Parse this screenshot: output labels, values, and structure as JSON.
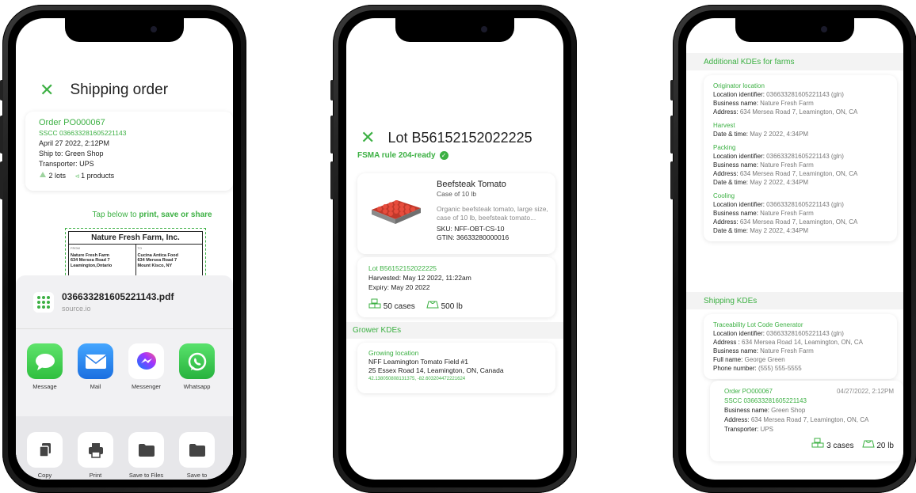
{
  "phone1": {
    "title": "Shipping order",
    "order": {
      "title": "Order PO000067",
      "sscc": "SSCC 036633281605221143",
      "date": "April 27 2022, 2:12PM",
      "ship_to": "Ship to: Green Shop",
      "transporter": "Transporter: UPS",
      "lots": "2 lots",
      "products": "1 products"
    },
    "tap_prefix": "Tap below to ",
    "tap_actions": "print, save or share",
    "label": {
      "company": "Nature Fresh Farm, Inc.",
      "from_label": "FROM",
      "from_lines": [
        "Nature Fresh Farm",
        "634 Mersea Road 7",
        "Leamington,Ontario"
      ],
      "to_label": "TO",
      "to_lines": [
        "Cucina Antica Food",
        "634 Mersea Road 7",
        "Mount Kisco, NY"
      ]
    },
    "share": {
      "file_name": "036633281605221143.pdf",
      "file_source": "source.io",
      "apps": [
        {
          "label": "Message",
          "icon": "message-icon"
        },
        {
          "label": "Mail",
          "icon": "mail-icon"
        },
        {
          "label": "Messenger",
          "icon": "messenger-icon"
        },
        {
          "label": "Whatsapp",
          "icon": "whatsapp-icon"
        }
      ],
      "actions": [
        {
          "label": "Copy",
          "icon": "copy-icon"
        },
        {
          "label": "Print",
          "icon": "print-icon"
        },
        {
          "label": "Save to Files",
          "icon": "folder-icon"
        },
        {
          "label": "Save to Dropbox",
          "icon": "folder-icon"
        }
      ]
    }
  },
  "phone2": {
    "title": "Lot B56152152022225",
    "fsma": "FSMA rule 204-ready",
    "product": {
      "name": "Beefsteak Tomato",
      "pack": "Case of 10 lb",
      "description": "Organic beefsteak tomato, large size, case of 10 lb, beefsteak tomato...",
      "sku": "SKU: NFF-OBT-CS-10",
      "gtin": "GTIN: 36633280000016"
    },
    "lot": {
      "lot": "Lot B56152152022225",
      "harvested": "Harvested: May 12 2022, 11:22am",
      "expiry": "Expiry: May 20 2022",
      "cases": "50 cases",
      "weight": "500 lb"
    },
    "grower_section": "Grower KDEs",
    "grower": {
      "label": "Growing location",
      "field": "NFF Leamington Tomato Field #1",
      "address": "25 Essex Road 14, Leamington, ON, Canada",
      "coords": "42.138050808131375, -82.603204472221624"
    }
  },
  "phone3": {
    "farms_section": "Additional KDEs for farms",
    "originator": {
      "title": "Originator location",
      "location_label": "Location identifier:",
      "location_value": "036633281605221143 (gln)",
      "business_label": "Business name:",
      "business_value": "Nature Fresh Farm",
      "address_label": "Address:",
      "address_value": "634 Mersea Road 7, Leamington, ON, CA"
    },
    "harvest": {
      "title": "Harvest",
      "date_label": "Date & time:",
      "date_value": "May 2 2022, 4:34PM"
    },
    "packing": {
      "title": "Packing",
      "location_label": "Location identifier:",
      "location_value": "036633281605221143 (gln)",
      "business_label": "Business name:",
      "business_value": "Nature Fresh Farm",
      "address_label": "Address:",
      "address_value": "634 Mersea Road 7, Leamington, ON, CA",
      "date_label": "Date & time:",
      "date_value": "May 2 2022, 4:34PM"
    },
    "cooling": {
      "title": "Cooling",
      "location_label": "Location identifier:",
      "location_value": "036633281605221143 (gln)",
      "business_label": "Business name:",
      "business_value": "Nature Fresh Farm",
      "address_label": "Address:",
      "address_value": "634 Mersea Road 7, Leamington, ON, CA",
      "date_label": "Date & time:",
      "date_value": "May 2 2022, 4:34PM"
    },
    "shipping_section": "Shipping KDEs",
    "tlc": {
      "title": "Traceability Lot Code Generator",
      "location_label": "Location identifier:",
      "location_value": "036633281605221143 (gln)",
      "address_label": "Address :",
      "address_value": "634 Mersea Road 14, Leamington, ON, CA",
      "business_label": "Business name:",
      "business_value": "Nature Fresh Farm",
      "fullname_label": "Full name:",
      "fullname_value": "George Green",
      "phone_label": "Phone number:",
      "phone_value": "(555) 555-5555"
    },
    "order": {
      "title": "Order PO000067",
      "date": "04/27/2022, 2:12PM",
      "sscc": "SSCC 036633281605221143",
      "business_label": "Business name:",
      "business_value": "Green Shop",
      "address_label": "Address:",
      "address_value": "634 Mersea Road 7, Leamington, ON, CA",
      "transporter_label": "Transporter:",
      "transporter_value": "UPS",
      "cases": "3 cases",
      "weight": "20 lb"
    }
  }
}
